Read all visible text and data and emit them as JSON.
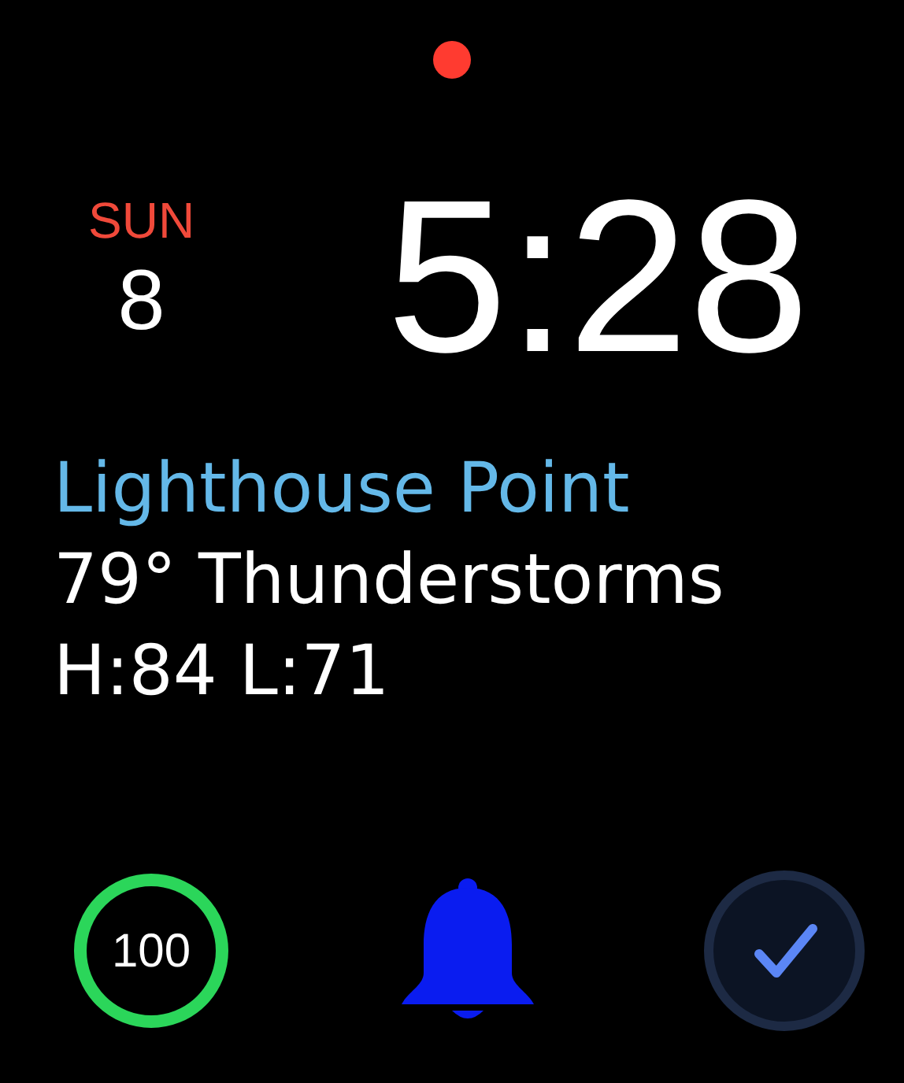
{
  "notification": {
    "unread": true
  },
  "date": {
    "weekday": "SUN",
    "day": "8"
  },
  "time": "5:28",
  "weather": {
    "location": "Lighthouse Point",
    "condition": "79° Thunderstorms",
    "range": "H:84 L:71"
  },
  "complications": [
    {
      "kind": "ring",
      "text": "100"
    },
    {
      "kind": "bell"
    },
    {
      "kind": "check"
    }
  ]
}
